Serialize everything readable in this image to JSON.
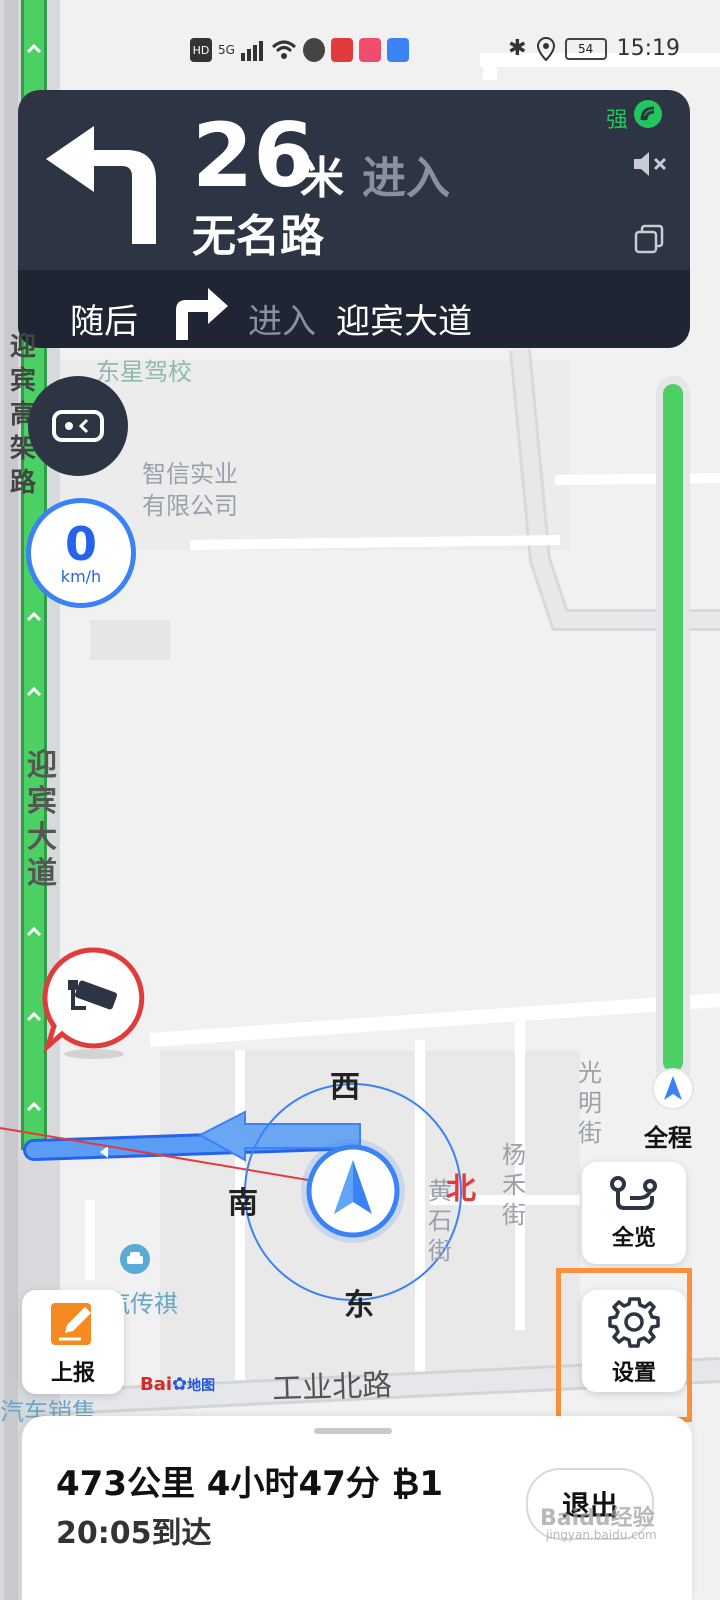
{
  "status_bar": {
    "left_badges": [
      "HD",
      "5G"
    ],
    "battery": "54",
    "time": "15:19"
  },
  "guidance": {
    "signal_strength": "强",
    "distance_value": "26",
    "distance_unit": "米",
    "enter_label": "进入",
    "road_name": "无名路",
    "then_label": "随后",
    "then_enter_label": "进入",
    "then_road": "迎宾大道"
  },
  "map": {
    "poi_labels": [
      "东星驾校",
      "智信实业",
      "有限公司",
      "广汽传祺",
      "汽车销售"
    ],
    "road_labels": {
      "yingbin_elevated": "迎宾高架路",
      "yingbin_avenue": "迎宾大道",
      "guangming_street": "光明街",
      "yanghe_street": "杨禾街",
      "huangshi_street": "黄石街",
      "gongye_north_road": "工业北路"
    },
    "compass": {
      "north": "北",
      "south": "南",
      "east": "东",
      "west": "西"
    },
    "brand": {
      "name": "Bai",
      "suffix": "地图"
    },
    "watermark": "Baidu经验",
    "watermark_sub": "jingyan.baidu.com"
  },
  "speed": {
    "value": "0",
    "unit": "km/h"
  },
  "route_progress": {
    "label": "全程",
    "fraction_complete": 0.0
  },
  "buttons": {
    "overview": "全览",
    "settings": "设置",
    "report": "上报",
    "exit": "退出"
  },
  "trip": {
    "summary": "473公里 4小时47分 ₿1",
    "arrival": "20:05到达"
  },
  "colors": {
    "card_bg": "#2d3443",
    "route_green": "#4ccf63",
    "route_blue": "#3b82f6",
    "highlight": "#f7913b"
  }
}
